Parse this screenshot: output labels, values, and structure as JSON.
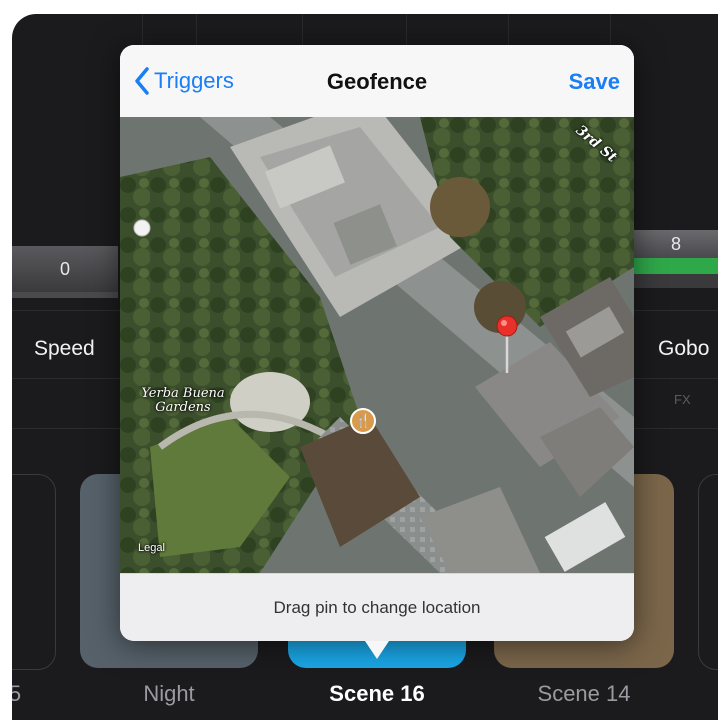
{
  "popover": {
    "title": "Geofence",
    "back_label": "Triggers",
    "save_label": "Save",
    "hint": "Drag pin to change location",
    "map": {
      "place_label": "Yerba Buena Gardens",
      "street_label": "3rd St",
      "legal_label": "Legal"
    }
  },
  "channels": [
    {
      "label": "Speed",
      "value": "0"
    },
    {
      "label": "Gobo",
      "value": "8",
      "fx": "FX"
    }
  ],
  "scenes": [
    {
      "label": "5"
    },
    {
      "label": "Night"
    },
    {
      "label": "Scene 16",
      "selected": true
    },
    {
      "label": "Scene 14"
    }
  ],
  "colors": {
    "accent": "#1a7ef5",
    "green_fader": "#2fa84a",
    "selected_scene": "#1aa7e6",
    "night_scene": "#56616a",
    "scene14": "#7b664a"
  }
}
